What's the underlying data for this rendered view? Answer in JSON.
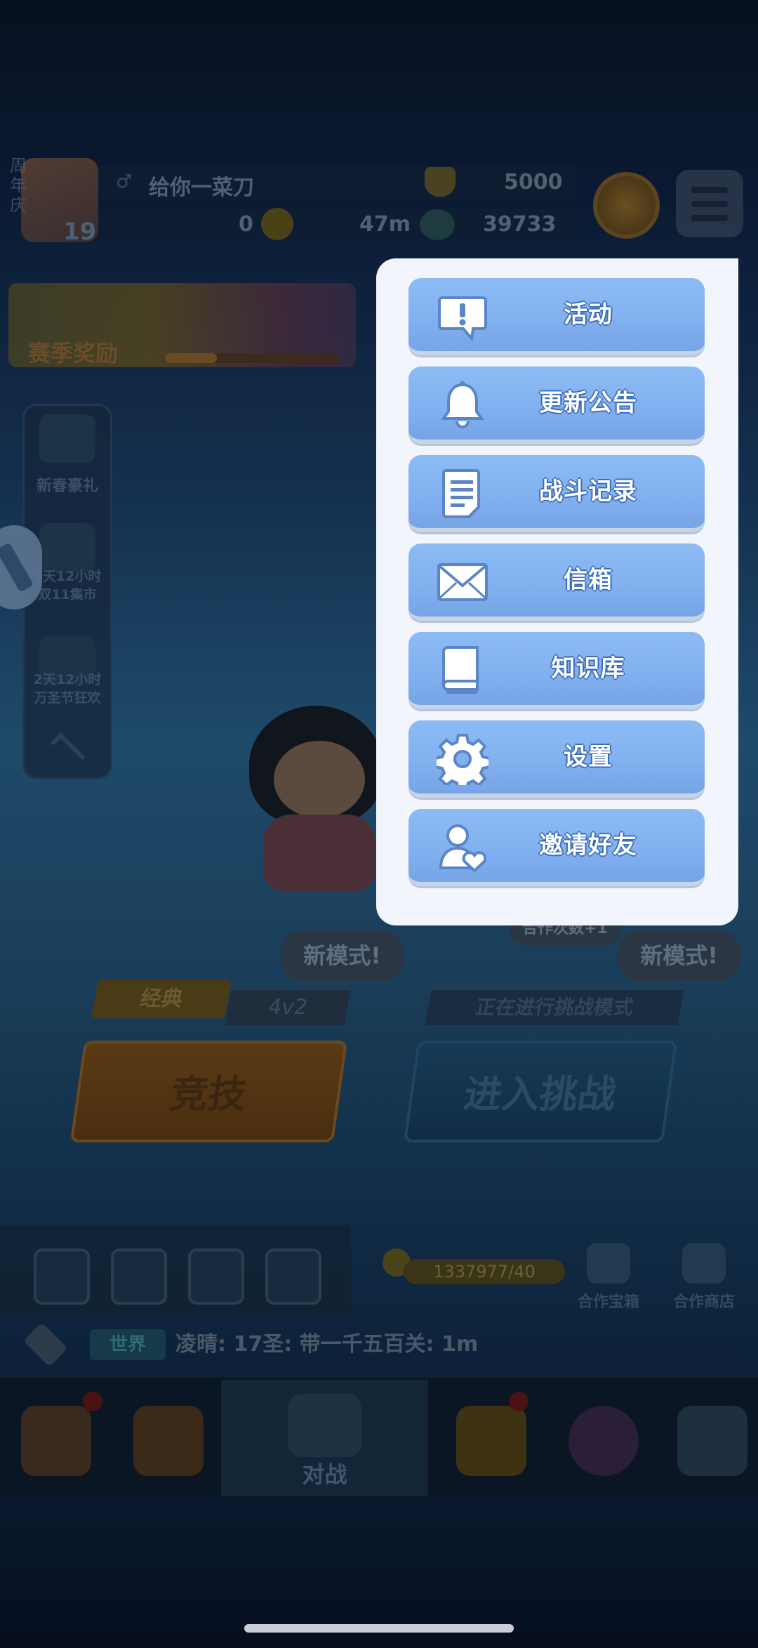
{
  "player": {
    "name": "给你一菜刀",
    "level": "19",
    "trophies": "5000",
    "resource_a": "0",
    "distance": "47m",
    "gems": "39733",
    "side_tag": "周年庆"
  },
  "season": {
    "label": "赛季奖励"
  },
  "left_panel": {
    "items": [
      {
        "label": "新春豪礼"
      },
      {
        "label": "3天12小时 双11集市"
      },
      {
        "label": "2天12小时 万圣节狂欢"
      }
    ]
  },
  "speech": {
    "left": "新模式!",
    "right": "新模式!",
    "top": "合作次数+1"
  },
  "modes": {
    "classic_tag": "经典",
    "classic_sub": "4v2",
    "challenge_tag": "正在进行挑战模式",
    "compete_button": "竞技",
    "challenge_button": "进入挑战"
  },
  "toolbar": {
    "keys": "1337977/40",
    "coop_box": "合作宝箱",
    "coop_shop": "合作商店"
  },
  "chat": {
    "channel": "世界",
    "message": "凌晴:  17圣: 带一千五百关: 1m"
  },
  "bottom_nav": {
    "battle_label": "对战"
  },
  "popup_menu": {
    "items": [
      {
        "label": "活动",
        "icon": "exclamation-bubble-icon"
      },
      {
        "label": "更新公告",
        "icon": "bell-icon"
      },
      {
        "label": "战斗记录",
        "icon": "document-icon"
      },
      {
        "label": "信箱",
        "icon": "envelope-icon"
      },
      {
        "label": "知识库",
        "icon": "book-icon"
      },
      {
        "label": "设置",
        "icon": "gear-icon"
      },
      {
        "label": "邀请好友",
        "icon": "user-heart-icon"
      }
    ]
  },
  "colors": {
    "menu_button": "#82b1f0",
    "menu_icon": "#5a86c8",
    "popup_bg": "#f2f6fc",
    "label_outline": "#3b6cb8"
  }
}
